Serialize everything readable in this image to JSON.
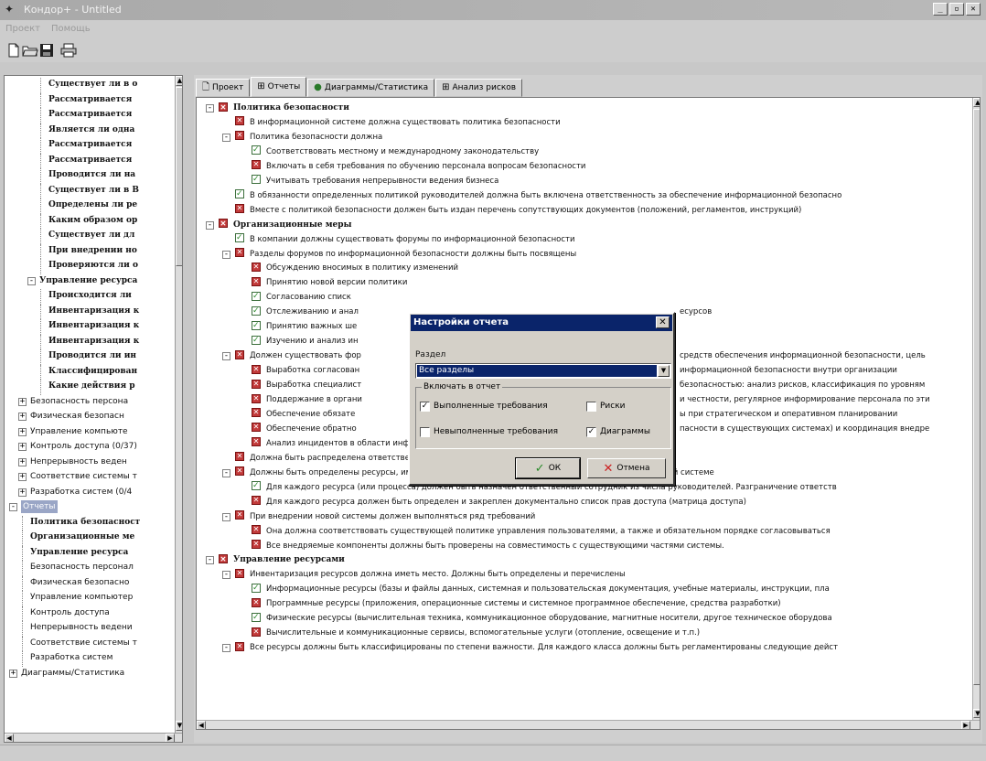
{
  "window": {
    "title": "Кондор+ - Untitled",
    "controls": [
      "_",
      "▫",
      "✕"
    ]
  },
  "menu": [
    "Проект",
    "Помощь"
  ],
  "toolbar": [
    "new-document",
    "open-folder",
    "save",
    "print"
  ],
  "left_tree": [
    {
      "text": "Существует ли в о",
      "bold": true,
      "indent": 3
    },
    {
      "text": "Рассматривается",
      "bold": true,
      "indent": 3
    },
    {
      "text": "Рассматривается",
      "bold": true,
      "indent": 3
    },
    {
      "text": "Является ли одна",
      "bold": true,
      "indent": 3
    },
    {
      "text": "Рассматривается",
      "bold": true,
      "indent": 3
    },
    {
      "text": "Рассматривается",
      "bold": true,
      "indent": 3
    },
    {
      "text": "Проводится ли на",
      "bold": true,
      "indent": 3
    },
    {
      "text": "Существует ли в В",
      "bold": true,
      "indent": 3
    },
    {
      "text": "Определены ли ре",
      "bold": true,
      "indent": 3
    },
    {
      "text": "Каким образом ор",
      "bold": true,
      "indent": 3
    },
    {
      "text": "Существует ли дл",
      "bold": true,
      "indent": 3
    },
    {
      "text": "При внедрении но",
      "bold": true,
      "indent": 3
    },
    {
      "text": "Проверяются ли о",
      "bold": true,
      "indent": 3
    },
    {
      "text": "Управление ресурса",
      "bold": true,
      "indent": 2,
      "exp": "-"
    },
    {
      "text": "Происходится ли",
      "bold": true,
      "indent": 3
    },
    {
      "text": "Инвентаризация к",
      "bold": true,
      "indent": 3
    },
    {
      "text": "Инвентаризация к",
      "bold": true,
      "indent": 3
    },
    {
      "text": "Инвентаризация к",
      "bold": true,
      "indent": 3
    },
    {
      "text": "Проводится ли ин",
      "bold": true,
      "indent": 3
    },
    {
      "text": "Классифицирован",
      "bold": true,
      "indent": 3
    },
    {
      "text": "Какие действия р",
      "bold": true,
      "indent": 3
    },
    {
      "text": "Безопасность персона",
      "bold": false,
      "indent": 1,
      "exp": "+"
    },
    {
      "text": "Физическая безопасн",
      "bold": false,
      "indent": 1,
      "exp": "+"
    },
    {
      "text": "Управление компьюте",
      "bold": false,
      "indent": 1,
      "exp": "+"
    },
    {
      "text": "Контроль доступа (0/37)",
      "bold": false,
      "indent": 1,
      "exp": "+"
    },
    {
      "text": "Непрерывность веден",
      "bold": false,
      "indent": 1,
      "exp": "+"
    },
    {
      "text": "Соответствие системы т",
      "bold": false,
      "indent": 1,
      "exp": "+"
    },
    {
      "text": "Разработка систем (0/4",
      "bold": false,
      "indent": 1,
      "exp": "+"
    },
    {
      "text": "Отчеты",
      "bold": false,
      "indent": 0,
      "exp": "-",
      "selected": true
    },
    {
      "text": "Политика безопасност",
      "bold": true,
      "indent": 1
    },
    {
      "text": "Организационные ме",
      "bold": true,
      "indent": 1
    },
    {
      "text": "Управление ресурса",
      "bold": true,
      "indent": 1
    },
    {
      "text": "Безопасность персонал",
      "bold": false,
      "indent": 1
    },
    {
      "text": "Физическая безопасно",
      "bold": false,
      "indent": 1
    },
    {
      "text": "Управление компьютер",
      "bold": false,
      "indent": 1
    },
    {
      "text": "Контроль доступа",
      "bold": false,
      "indent": 1
    },
    {
      "text": "Непрерывность ведени",
      "bold": false,
      "indent": 1
    },
    {
      "text": "Соответствие системы т",
      "bold": false,
      "indent": 1
    },
    {
      "text": "Разработка систем",
      "bold": false,
      "indent": 1
    },
    {
      "text": "Диаграммы/Статистика",
      "bold": false,
      "indent": 0,
      "exp": "+"
    }
  ],
  "tabs": [
    {
      "label": "Проект",
      "icon": "document-icon",
      "active": false
    },
    {
      "label": "Отчеты",
      "icon": "table-icon",
      "active": true
    },
    {
      "label": "Диаграммы/Статистика",
      "icon": "pie-chart-icon",
      "active": false
    },
    {
      "label": "Анализ рисков",
      "icon": "table-icon",
      "active": false
    }
  ],
  "report_rows": [
    {
      "level": 0,
      "mark": "x",
      "exp": "-",
      "header": true,
      "text": "Политика безопасности"
    },
    {
      "level": 1,
      "mark": "x",
      "text": "В информационной системе должна существовать политика безопасности"
    },
    {
      "level": 1,
      "mark": "x",
      "exp": "-",
      "text": "Политика безопасности должна"
    },
    {
      "level": 2,
      "mark": "ok",
      "text": "Соответствовать местному и международному законодательству"
    },
    {
      "level": 2,
      "mark": "x",
      "text": "Включать в себя требования по обучению персонала вопросам безопасности"
    },
    {
      "level": 2,
      "mark": "ok",
      "text": "Учитывать требования непрерывности ведения бизнеса"
    },
    {
      "level": 1,
      "mark": "ok",
      "text": "В обязанности определенных политикой руководителей должна быть включена ответственность за обеспечение информационной безопасно"
    },
    {
      "level": 1,
      "mark": "x",
      "text": "Вместе с политикой безопасности должен быть издан перечень сопутствующих документов (положений, регламентов, инструкций)"
    },
    {
      "level": 0,
      "mark": "x",
      "exp": "-",
      "header": true,
      "text": "Организационные меры"
    },
    {
      "level": 1,
      "mark": "ok",
      "text": "В компании должны существовать форумы по информационной безопасности"
    },
    {
      "level": 1,
      "mark": "x",
      "exp": "-",
      "text": "Разделы форумов по информационной безопасности должны быть посвящены"
    },
    {
      "level": 2,
      "mark": "x",
      "text": "Обсуждению вносимых в политику изменений"
    },
    {
      "level": 2,
      "mark": "x",
      "text": "Принятию новой версии политики"
    },
    {
      "level": 2,
      "mark": "ok",
      "text": "Согласованию списк"
    },
    {
      "level": 2,
      "mark": "ok",
      "text": "Отслеживанию и анал",
      "tail": "есурсов"
    },
    {
      "level": 2,
      "mark": "ok",
      "text": "Принятию важных ше"
    },
    {
      "level": 2,
      "mark": "ok",
      "text": "Изучению и анализ ин"
    },
    {
      "level": 1,
      "mark": "x",
      "exp": "-",
      "text": "Должен существовать фор",
      "tail": "средств обеспечения информационной безопасности, цель"
    },
    {
      "level": 2,
      "mark": "x",
      "text": "Выработка согласован",
      "tail": "информационной безопасности внутри организации"
    },
    {
      "level": 2,
      "mark": "x",
      "text": "Выработка специалист",
      "tail": "безопасностью: анализ рисков, классификация по уровням"
    },
    {
      "level": 2,
      "mark": "x",
      "text": "Поддержание в органи",
      "tail": "и честности, регулярное информирование персонала по эти"
    },
    {
      "level": 2,
      "mark": "x",
      "text": "Обеспечение обязате",
      "tail": "ы при стратегическом и оперативном планировании"
    },
    {
      "level": 2,
      "mark": "x",
      "text": "Обеспечение обратно",
      "tail": "пасности в существующих системах) и координация внедре"
    },
    {
      "level": 2,
      "mark": "x",
      "text": "Анализ инцидентов в области информационной безопасности и выработка рекомендаций"
    },
    {
      "level": 1,
      "mark": "x",
      "text": "Должна быть распределена ответственность за обеспечение безопасности"
    },
    {
      "level": 1,
      "mark": "x",
      "exp": "-",
      "text": "Должны быть определены ресурсы, имеющие отношение к информационной безопасности, по каждой системе"
    },
    {
      "level": 2,
      "mark": "ok",
      "text": "Для каждого ресурса (или процесса) должен быть назначен ответственный сотрудник из числа руководителей. Разграничение ответств"
    },
    {
      "level": 2,
      "mark": "x",
      "text": "Для каждого ресурса должен быть определен и закреплен документально список прав доступа (матрица доступа)"
    },
    {
      "level": 1,
      "mark": "x",
      "exp": "-",
      "text": "При внедрении новой системы должен выполняться ряд требований"
    },
    {
      "level": 2,
      "mark": "x",
      "text": "Она должна соответствовать существующей политике управления пользователями, а также и обязательном порядке согласовываться"
    },
    {
      "level": 2,
      "mark": "x",
      "text": "Все внедряемые компоненты должны быть проверены на совместимость с существующими частями системы."
    },
    {
      "level": 0,
      "mark": "x",
      "exp": "-",
      "header": true,
      "text": "Управление ресурсами"
    },
    {
      "level": 1,
      "mark": "x",
      "exp": "-",
      "text": "Инвентаризация ресурсов должна иметь место. Должны быть определены и перечислены"
    },
    {
      "level": 2,
      "mark": "ok",
      "text": "Информационные ресурсы (базы и файлы данных, системная и пользовательская документация, учебные материалы, инструкции, пла"
    },
    {
      "level": 2,
      "mark": "x",
      "text": "Программные ресурсы (приложения, операционные системы и системное программное обеспечение, средства разработки)"
    },
    {
      "level": 2,
      "mark": "ok",
      "text": "Физические ресурсы (вычислительная техника, коммуникационное оборудование, магнитные носители, другое техническое оборудова"
    },
    {
      "level": 2,
      "mark": "x",
      "text": "Вычислительные и коммуникационные сервисы, вспомогательные услуги (отопление, освещение и т.п.)"
    },
    {
      "level": 1,
      "mark": "x",
      "exp": "-",
      "text": "Все ресурсы должны быть классифицированы по степени важности. Для каждого класса должны быть регламентированы следующие дейст"
    }
  ],
  "dialog": {
    "title": "Настройки отчета",
    "close": "✕",
    "section_label": "Раздел",
    "section_value": "Все разделы",
    "group_title": "Включать в отчет",
    "checks": [
      {
        "label": "Выполненные требования",
        "checked": true
      },
      {
        "label": "Риски",
        "checked": false
      },
      {
        "label": "Невыполненные требования",
        "checked": false
      },
      {
        "label": "Диаграммы",
        "checked": true
      }
    ],
    "ok_label": "ОК",
    "cancel_label": "Отмена"
  }
}
